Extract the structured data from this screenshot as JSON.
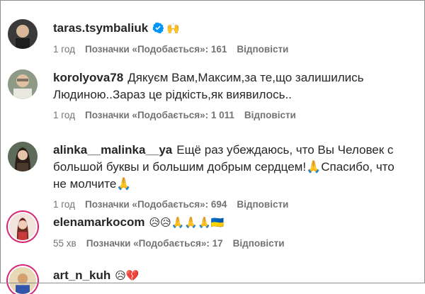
{
  "comments": [
    {
      "username": "taras.tsymbaliuk",
      "verified": true,
      "text": "🙌",
      "time": "1 год",
      "likes": "Позначки «Подобається»: 161",
      "reply": "Відповісти"
    },
    {
      "username": "korolyova78",
      "verified": false,
      "text": "Дякуєм Вам,Максим,за те,що залишились Людиною..Зараз це рідкість,як виявилось..",
      "time": "1 год",
      "likes": "Позначки «Подобається»: 1 011",
      "reply": "Відповісти"
    },
    {
      "username": "alinka__malinka__ya",
      "verified": false,
      "text": "Ещё раз убеждаюсь, что Вы Человек с большой буквы и большим добрым сердцем!🙏Спасибо, что не молчите🙏",
      "time": "1 год",
      "likes": "Позначки «Подобається»: 694",
      "reply": "Відповісти"
    },
    {
      "username": "elenamarkocom",
      "verified": false,
      "text": "😥😥🙏🙏🙏🇺🇦",
      "time": "55 хв",
      "likes": "Позначки «Подобається»: 17",
      "reply": "Відповісти"
    },
    {
      "username": "art_n_kuh",
      "verified": false,
      "text": "😥💔",
      "time": "",
      "likes": "",
      "reply": ""
    }
  ],
  "colors": {
    "text": "#262626",
    "meta": "#737373",
    "verified": "#0095f6",
    "story_ring": "#d62976"
  },
  "icons": {
    "verified_badge": "verified-badge-icon"
  }
}
